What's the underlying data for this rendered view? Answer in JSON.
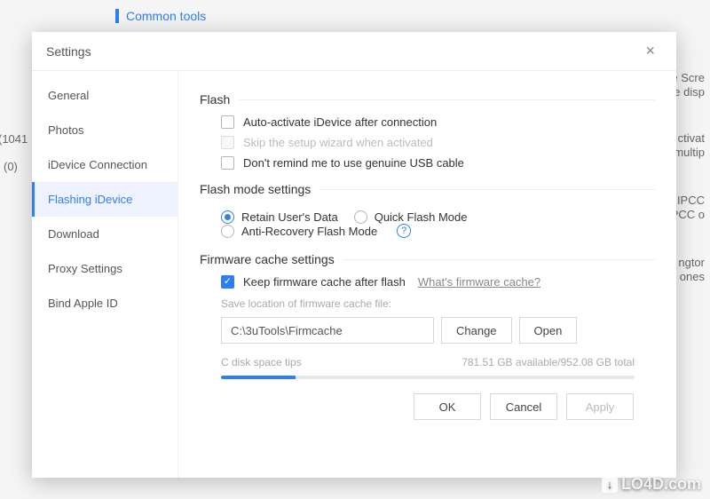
{
  "background": {
    "common_tools": "Common tools",
    "left_count1": "(1041",
    "left_count2": "(0)",
    "right_fragments": [
      "e Scre",
      "e disp",
      "ctivat",
      "multip",
      "IPCC",
      "PCC o",
      "ngtor",
      "ones"
    ]
  },
  "dialog": {
    "title": "Settings"
  },
  "sidebar": {
    "items": [
      {
        "label": "General"
      },
      {
        "label": "Photos"
      },
      {
        "label": "iDevice Connection"
      },
      {
        "label": "Flashing iDevice"
      },
      {
        "label": "Download"
      },
      {
        "label": "Proxy Settings"
      },
      {
        "label": "Bind Apple ID"
      }
    ],
    "active_index": 3
  },
  "sections": {
    "flash": {
      "title": "Flash",
      "auto_activate": "Auto-activate iDevice after connection",
      "skip_wizard": "Skip the setup wizard when activated",
      "dont_remind_cable": "Don't remind me to use genuine USB cable"
    },
    "flash_mode": {
      "title": "Flash mode settings",
      "options": [
        "Retain User's Data",
        "Quick Flash Mode",
        "Anti-Recovery Flash Mode"
      ],
      "selected_index": 0
    },
    "firmware_cache": {
      "title": "Firmware cache settings",
      "keep_cache": "Keep firmware cache after flash",
      "whats_link": "What's firmware cache?",
      "save_location_label": "Save location of firmware cache file:",
      "path_value": "C:\\3uTools\\Firmcache",
      "change_btn": "Change",
      "open_btn": "Open",
      "disk_tips_label": "C disk space tips",
      "disk_space": "781.51 GB available/952.08 GB total",
      "progress_percent": 18
    }
  },
  "footer": {
    "ok": "OK",
    "cancel": "Cancel",
    "apply": "Apply"
  },
  "watermark": "LO4D.com"
}
